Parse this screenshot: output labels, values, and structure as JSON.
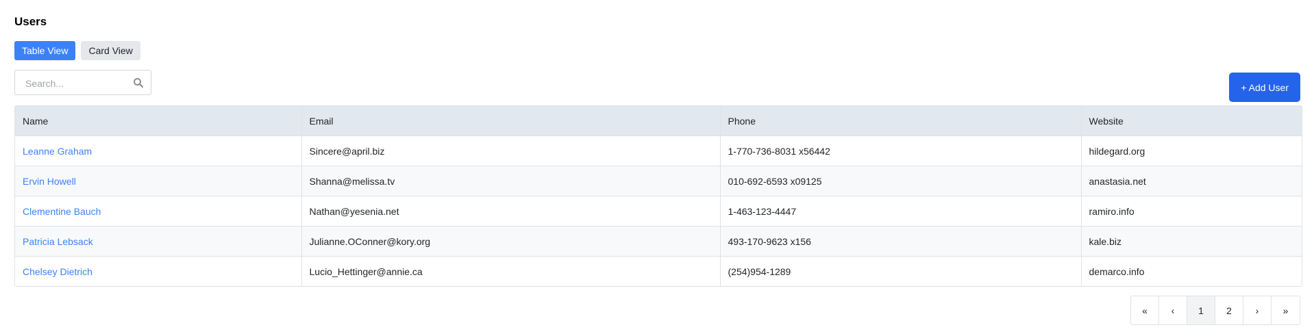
{
  "page": {
    "title": "Users"
  },
  "view_toggle": {
    "table_label": "Table View",
    "card_label": "Card View",
    "active": "table"
  },
  "search": {
    "placeholder": "Search...",
    "value": ""
  },
  "add_button": {
    "label": "+ Add User"
  },
  "table": {
    "columns": [
      "Name",
      "Email",
      "Phone",
      "Website"
    ],
    "rows": [
      {
        "name": "Leanne Graham",
        "email": "Sincere@april.biz",
        "phone": "1-770-736-8031 x56442",
        "website": "hildegard.org"
      },
      {
        "name": "Ervin Howell",
        "email": "Shanna@melissa.tv",
        "phone": "010-692-6593 x09125",
        "website": "anastasia.net"
      },
      {
        "name": "Clementine Bauch",
        "email": "Nathan@yesenia.net",
        "phone": "1-463-123-4447",
        "website": "ramiro.info"
      },
      {
        "name": "Patricia Lebsack",
        "email": "Julianne.OConner@kory.org",
        "phone": "493-170-9623 x156",
        "website": "kale.biz"
      },
      {
        "name": "Chelsey Dietrich",
        "email": "Lucio_Hettinger@annie.ca",
        "phone": "(254)954-1289",
        "website": "demarco.info"
      }
    ]
  },
  "pagination": {
    "first": "«",
    "prev": "‹",
    "pages": [
      "1",
      "2"
    ],
    "current": "1",
    "next": "›",
    "last": "»"
  },
  "colors": {
    "accent": "#3b82f6",
    "primary_button": "#2563eb",
    "header_bg": "#e2e8f0"
  },
  "icons": {
    "search": "search-icon"
  }
}
